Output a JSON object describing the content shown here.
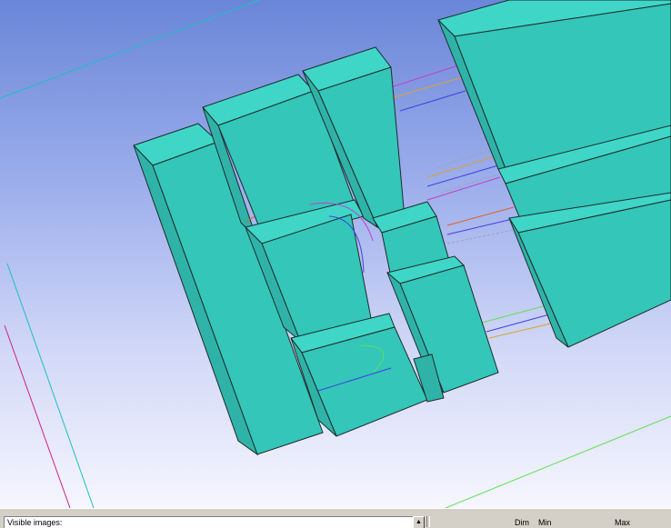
{
  "bottom_panel": {
    "visible_images_label": "Visible images:",
    "scroll_up_glyph": "▲",
    "columns": {
      "dim": "Dim",
      "min": "Min",
      "max": "Max"
    }
  },
  "viewport": {
    "background_top": "#6a86d8",
    "background_bottom": "#f6f6fe",
    "solid_fill": "#33c6b9",
    "solid_edge": "#1f2b2a"
  }
}
